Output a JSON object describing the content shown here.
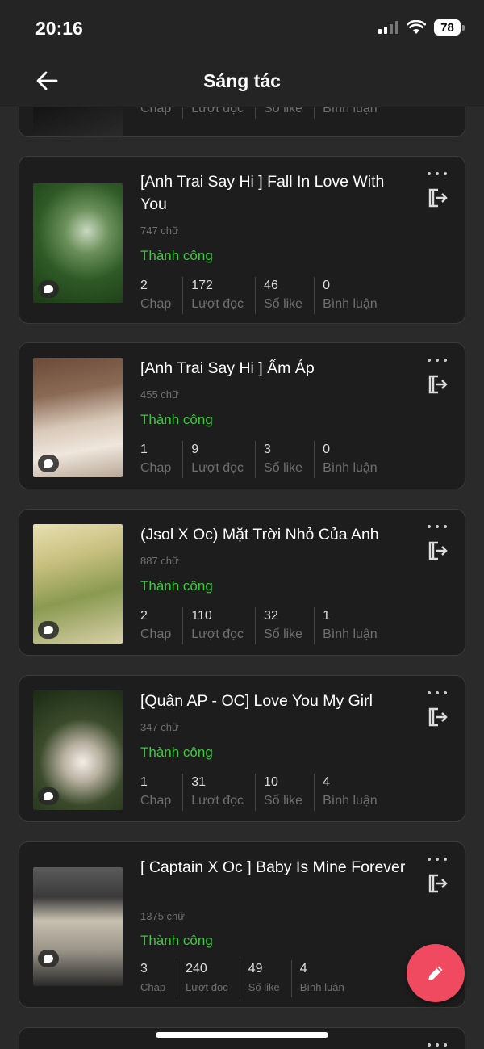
{
  "status_bar": {
    "time": "20:16",
    "battery": "78"
  },
  "header": {
    "title": "Sáng tác"
  },
  "stat_labels": {
    "chap": "Chap",
    "reads": "Lượt đọc",
    "likes": "Số like",
    "comments": "Bình luận"
  },
  "stories": [
    {
      "title": "",
      "words": "",
      "status": "",
      "chap": "",
      "reads": "",
      "likes": "",
      "comments": ""
    },
    {
      "title": "[Anh Trai Say Hi ] Fall In Love With You",
      "words": "747 chữ",
      "status": "Thành công",
      "chap": "2",
      "reads": "172",
      "likes": "46",
      "comments": "0"
    },
    {
      "title": "[Anh Trai Say Hi ] Ấm Áp",
      "words": "455 chữ",
      "status": "Thành công",
      "chap": "1",
      "reads": "9",
      "likes": "3",
      "comments": "0"
    },
    {
      "title": "(Jsol X Oc) Mặt Trời Nhỏ Của Anh",
      "words": "887 chữ",
      "status": "Thành công",
      "chap": "2",
      "reads": "110",
      "likes": "32",
      "comments": "1"
    },
    {
      "title": "[Quân AP - OC] Love You My Girl",
      "words": "347 chữ",
      "status": "Thành công",
      "chap": "1",
      "reads": "31",
      "likes": "10",
      "comments": "4"
    },
    {
      "title": "[ Captain X Oc ] Baby Is Mine Forever",
      "words": "1375 chữ",
      "status": "Thành công",
      "chap": "3",
      "reads": "240",
      "likes": "49",
      "comments": "4"
    }
  ],
  "colors": {
    "success": "#3ec83e",
    "fab": "#ef4a5f",
    "card_bg": "#1d1d1d",
    "page_bg": "#2a2a2a"
  },
  "icons": {
    "back": "arrow-left-icon",
    "more": "more-horizontal-icon",
    "export": "export-icon",
    "compose": "pencil-icon",
    "comment": "chat-bubble-icon"
  }
}
